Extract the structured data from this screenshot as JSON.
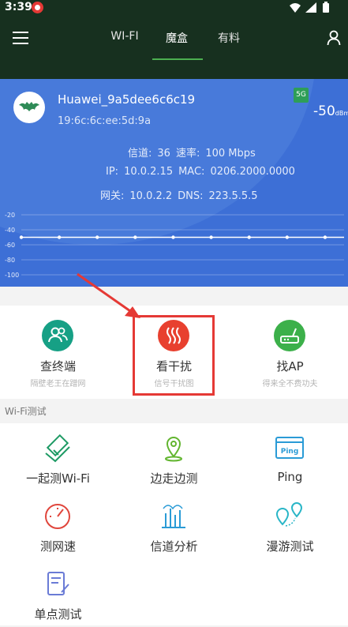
{
  "status_bar": {
    "time": "3:39",
    "icons": [
      "notification-icon",
      "wifi-icon",
      "signal-icon",
      "battery-icon"
    ]
  },
  "app_bar": {
    "tabs": [
      {
        "label": "WI-FI",
        "active": false
      },
      {
        "label": "魔盒",
        "active": true
      },
      {
        "label": "有料",
        "active": false
      }
    ],
    "accent": "#4caf50",
    "background": "#17301f"
  },
  "network": {
    "ssid": "Huawei_9a5dee6c6c19",
    "bssid": "19:6c:6c:ee:5d:9a",
    "band": "5G",
    "rssi": "-50",
    "rssi_unit": "dBm",
    "channel_label": "信道:",
    "channel": "36",
    "rate_label": "速率:",
    "rate": "100 Mbps",
    "ip_label": "IP:",
    "ip": "10.0.2.15",
    "mac_label": "MAC:",
    "mac": "0206.2000.0000",
    "gateway_label": "网关:",
    "gateway": "10.0.2.2",
    "dns_label": "DNS:",
    "dns": "223.5.5.5",
    "card_color": "#3d6fd6"
  },
  "chart_data": {
    "type": "line",
    "ylim": [
      -100,
      -20
    ],
    "y_ticks": [
      "-20",
      "-40",
      "-60",
      "-80",
      "-100"
    ],
    "series": [
      {
        "values": [
          -50,
          -50,
          -50,
          -50,
          -50,
          -50,
          -50,
          -50,
          -50,
          -50,
          -50,
          -50,
          -50,
          -50,
          -50,
          -50,
          -50,
          -50
        ]
      }
    ],
    "grid": true
  },
  "tools": [
    {
      "label": "查终端",
      "sub": "隔壁老王在蹭网",
      "icon": "users-icon",
      "color": "#16a085"
    },
    {
      "label": "看干扰",
      "sub": "信号干扰图",
      "icon": "interference-icon",
      "color": "#e8402f"
    },
    {
      "label": "找AP",
      "sub": "得来全不费功夫",
      "icon": "router-icon",
      "color": "#3cb04a"
    }
  ],
  "section_title": "Wi-Fi测试",
  "tests": [
    {
      "label": "一起测Wi-Fi",
      "icon": "handshake-icon"
    },
    {
      "label": "边走边测",
      "icon": "location-pin-icon"
    },
    {
      "label": "Ping",
      "icon": "ping-window-icon",
      "icon_text": "Ping"
    },
    {
      "label": "测网速",
      "icon": "speedometer-icon"
    },
    {
      "label": "信道分析",
      "icon": "bar-chart-icon"
    },
    {
      "label": "漫游测试",
      "icon": "roaming-pins-icon"
    },
    {
      "label": "单点测试",
      "icon": "document-edit-icon"
    }
  ],
  "annotation_color": "#e53935"
}
